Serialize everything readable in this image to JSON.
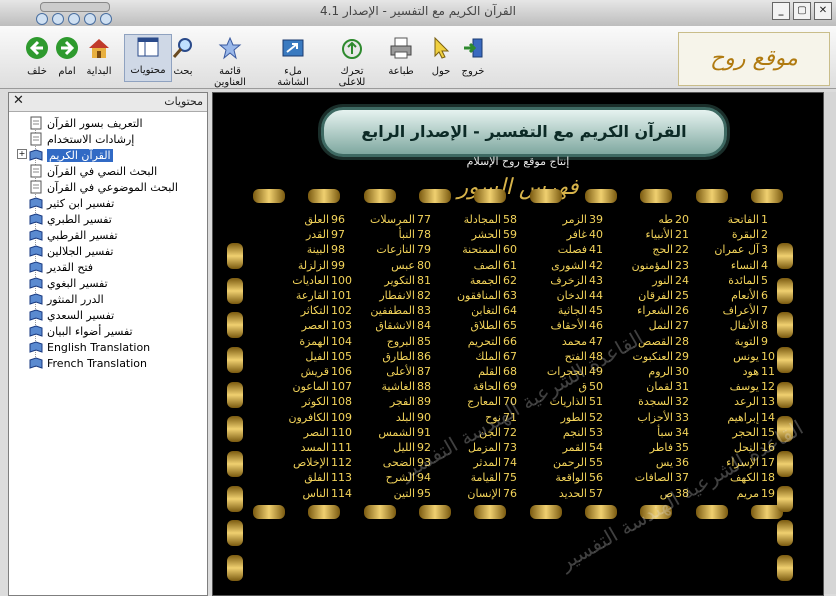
{
  "window": {
    "title": "القرآن الكريم مع التفسير - الإصدار 4.1",
    "buttons": [
      "_",
      "▢",
      "✕"
    ]
  },
  "toolbar": {
    "buttons": [
      {
        "label": "خلف",
        "icon": "back-arrow-icon"
      },
      {
        "label": "امام",
        "icon": "forward-arrow-icon"
      },
      {
        "label": "البداية",
        "icon": "home-icon"
      },
      {
        "label": "محتويات",
        "icon": "contents-icon"
      },
      {
        "label": "بحث",
        "icon": "search-icon"
      },
      {
        "label": "قائمة العناوين",
        "icon": "favorites-star-icon"
      },
      {
        "label": "ملء الشاشة",
        "icon": "fullscreen-icon"
      },
      {
        "label": "تحرك للاعلى",
        "icon": "move-up-icon"
      },
      {
        "label": "طباعة",
        "icon": "print-icon"
      },
      {
        "label": "حول",
        "icon": "about-pointer-icon"
      },
      {
        "label": "خروج",
        "icon": "exit-icon"
      }
    ],
    "logo": "موقع روح الإسلام"
  },
  "sidebar": {
    "title": "محتويات",
    "close": "✕",
    "items": [
      {
        "label": "التعريف بسور القرآن",
        "icon": "page-icon"
      },
      {
        "label": "إرشادات الاستخدام",
        "icon": "page-icon"
      },
      {
        "label": "القرآن الكريم",
        "icon": "book-icon",
        "selected": true
      },
      {
        "label": "البحث النصي في القرآن",
        "icon": "page-icon"
      },
      {
        "label": "البحث الموضوعي في القرآن",
        "icon": "page-icon"
      },
      {
        "label": "تفسير ابن كثير",
        "icon": "book-icon"
      },
      {
        "label": "تفسير الطبري",
        "icon": "book-icon"
      },
      {
        "label": "تفسير القرطبي",
        "icon": "book-icon"
      },
      {
        "label": "تفسير الجلالين",
        "icon": "book-icon"
      },
      {
        "label": "فتح القدير",
        "icon": "book-icon"
      },
      {
        "label": "تفسير البغوي",
        "icon": "book-icon"
      },
      {
        "label": "الدرر المنثور",
        "icon": "book-icon"
      },
      {
        "label": "تفسير السعدي",
        "icon": "book-icon"
      },
      {
        "label": "تفسير أضواء البيان",
        "icon": "book-icon"
      },
      {
        "label": "English Translation",
        "icon": "book-icon"
      },
      {
        "label": "French Translation",
        "icon": "book-icon"
      }
    ]
  },
  "content": {
    "banner": "القرآن الكريم مع التفسير - الإصدار الرابع",
    "subtitle": "إنتاج موقع روح الإسلام",
    "index_title": "فهرس السور",
    "watermark": "القاعدة الشرعية الهندسة التفسير",
    "columns": [
      [
        [
          "1",
          "الفاتحة"
        ],
        [
          "2",
          "البقرة"
        ],
        [
          "3",
          "آل عمران"
        ],
        [
          "4",
          "النساء"
        ],
        [
          "5",
          "المائدة"
        ],
        [
          "6",
          "الأنعام"
        ],
        [
          "7",
          "الأعراف"
        ],
        [
          "8",
          "الأنفال"
        ],
        [
          "9",
          "التوبة"
        ],
        [
          "10",
          "يونس"
        ],
        [
          "11",
          "هود"
        ],
        [
          "12",
          "يوسف"
        ],
        [
          "13",
          "الرعد"
        ],
        [
          "14",
          "إبراهيم"
        ],
        [
          "15",
          "الحجر"
        ],
        [
          "16",
          "النحل"
        ],
        [
          "17",
          "الإسراء"
        ],
        [
          "18",
          "الكهف"
        ],
        [
          "19",
          "مريم"
        ]
      ],
      [
        [
          "20",
          "طه"
        ],
        [
          "21",
          "الأنبياء"
        ],
        [
          "22",
          "الحج"
        ],
        [
          "23",
          "المؤمنون"
        ],
        [
          "24",
          "النور"
        ],
        [
          "25",
          "الفرقان"
        ],
        [
          "26",
          "الشعراء"
        ],
        [
          "27",
          "النمل"
        ],
        [
          "28",
          "القصص"
        ],
        [
          "29",
          "العنكبوت"
        ],
        [
          "30",
          "الروم"
        ],
        [
          "31",
          "لقمان"
        ],
        [
          "32",
          "السجدة"
        ],
        [
          "33",
          "الأحزاب"
        ],
        [
          "34",
          "سبأ"
        ],
        [
          "35",
          "فاطر"
        ],
        [
          "36",
          "يس"
        ],
        [
          "37",
          "الصافات"
        ],
        [
          "38",
          "ص"
        ]
      ],
      [
        [
          "39",
          "الزمر"
        ],
        [
          "40",
          "غافر"
        ],
        [
          "41",
          "فصلت"
        ],
        [
          "42",
          "الشورى"
        ],
        [
          "43",
          "الزخرف"
        ],
        [
          "44",
          "الدخان"
        ],
        [
          "45",
          "الجاثية"
        ],
        [
          "46",
          "الأحقاف"
        ],
        [
          "47",
          "محمد"
        ],
        [
          "48",
          "الفتح"
        ],
        [
          "49",
          "الحجرات"
        ],
        [
          "50",
          "ق"
        ],
        [
          "51",
          "الذاريات"
        ],
        [
          "52",
          "الطور"
        ],
        [
          "53",
          "النجم"
        ],
        [
          "54",
          "القمر"
        ],
        [
          "55",
          "الرحمن"
        ],
        [
          "56",
          "الواقعة"
        ],
        [
          "57",
          "الحديد"
        ]
      ],
      [
        [
          "58",
          "المجادلة"
        ],
        [
          "59",
          "الحشر"
        ],
        [
          "60",
          "الممتحنة"
        ],
        [
          "61",
          "الصف"
        ],
        [
          "62",
          "الجمعة"
        ],
        [
          "63",
          "المنافقون"
        ],
        [
          "64",
          "التغابن"
        ],
        [
          "65",
          "الطلاق"
        ],
        [
          "66",
          "التحريم"
        ],
        [
          "67",
          "الملك"
        ],
        [
          "68",
          "القلم"
        ],
        [
          "69",
          "الحاقة"
        ],
        [
          "70",
          "المعارج"
        ],
        [
          "71",
          "نوح"
        ],
        [
          "72",
          "الجن"
        ],
        [
          "73",
          "المزمل"
        ],
        [
          "74",
          "المدثر"
        ],
        [
          "75",
          "القيامة"
        ],
        [
          "76",
          "الإنسان"
        ]
      ],
      [
        [
          "77",
          "المرسلات"
        ],
        [
          "78",
          "النبأ"
        ],
        [
          "79",
          "النازعات"
        ],
        [
          "80",
          "عبس"
        ],
        [
          "81",
          "التكوير"
        ],
        [
          "82",
          "الانفطار"
        ],
        [
          "83",
          "المطففين"
        ],
        [
          "84",
          "الانشقاق"
        ],
        [
          "85",
          "البروج"
        ],
        [
          "86",
          "الطارق"
        ],
        [
          "87",
          "الأعلى"
        ],
        [
          "88",
          "الغاشية"
        ],
        [
          "89",
          "الفجر"
        ],
        [
          "90",
          "البلد"
        ],
        [
          "91",
          "الشمس"
        ],
        [
          "92",
          "الليل"
        ],
        [
          "93",
          "الضحى"
        ],
        [
          "94",
          "الشرح"
        ],
        [
          "95",
          "التين"
        ]
      ],
      [
        [
          "96",
          "العلق"
        ],
        [
          "97",
          "القدر"
        ],
        [
          "98",
          "البينة"
        ],
        [
          "99",
          "الزلزلة"
        ],
        [
          "100",
          "العاديات"
        ],
        [
          "101",
          "القارعة"
        ],
        [
          "102",
          "التكاثر"
        ],
        [
          "103",
          "العصر"
        ],
        [
          "104",
          "الهمزة"
        ],
        [
          "105",
          "الفيل"
        ],
        [
          "106",
          "قريش"
        ],
        [
          "107",
          "الماعون"
        ],
        [
          "108",
          "الكوثر"
        ],
        [
          "109",
          "الكافرون"
        ],
        [
          "110",
          "النصر"
        ],
        [
          "111",
          "المسد"
        ],
        [
          "112",
          "الإخلاص"
        ],
        [
          "113",
          "الفلق"
        ],
        [
          "114",
          "الناس"
        ]
      ]
    ]
  }
}
